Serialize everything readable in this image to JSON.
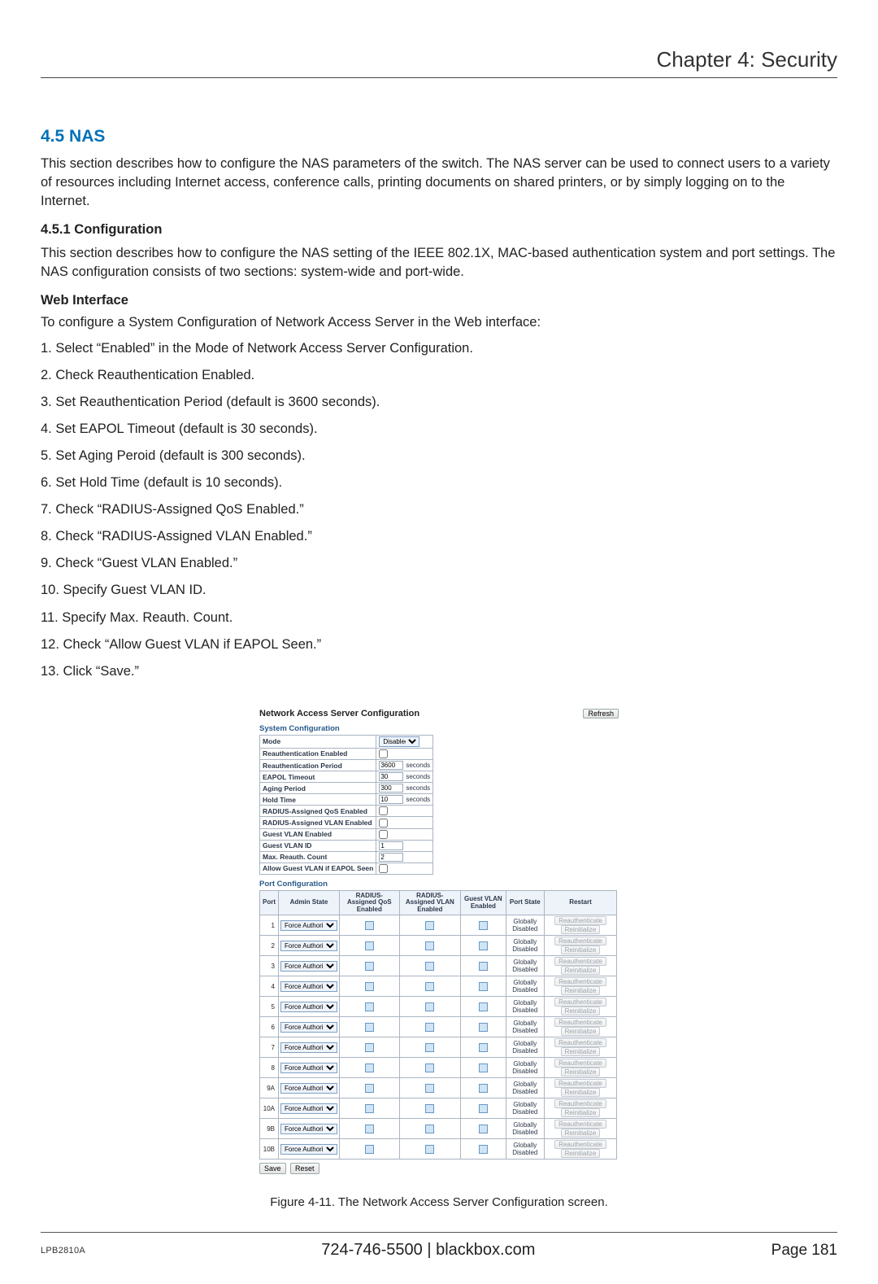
{
  "header": {
    "chapter": "Chapter 4: Security"
  },
  "section": {
    "number_title": "4.5 NAS",
    "intro": "This section describes how to configure the NAS parameters of the switch. The NAS server can be used to connect users to a variety of resources including Internet access, conference calls, printing documents on shared printers, or by simply logging on to the Internet.",
    "sub1_title": "4.5.1 Configuration",
    "sub1_text": "This section describes how to configure the NAS setting of the IEEE 802.1X, MAC-based authentication system and port settings. The NAS configuration consists of two sections: system-wide and port-wide.",
    "webif_title": "Web Interface",
    "webif_intro": "To configure a System Configuration of Network Access Server in the Web interface:",
    "steps": [
      "1. Select “Enabled” in the Mode of Network Access Server Configuration.",
      "2. Check Reauthentication Enabled.",
      "3. Set Reauthentication Period (default is 3600 seconds).",
      "4. Set EAPOL Timeout (default is 30 seconds).",
      "5. Set Aging Peroid (default is 300 seconds).",
      "6. Set Hold Time (default is 10 seconds).",
      "7. Check “RADIUS-Assigned QoS Enabled.”",
      "8. Check “RADIUS-Assigned VLAN Enabled.”",
      "9. Check “Guest VLAN Enabled.”",
      "10. Specify Guest VLAN ID.",
      "11. Specify Max. Reauth. Count.",
      "12. Check “Allow Guest VLAN if EAPOL Seen.”",
      "13. Click “Save.”"
    ]
  },
  "figure": {
    "caption": "Figure 4-11. The Network Access Server Configuration screen.",
    "panel_title": "Network Access Server Configuration",
    "refresh": "Refresh",
    "sysconf_heading": "System Configuration",
    "portconf_heading": "Port Configuration",
    "sys": {
      "mode_label": "Mode",
      "mode_value": "Disabled",
      "reauth_en_label": "Reauthentication Enabled",
      "reauth_period_label": "Reauthentication Period",
      "reauth_period_value": "3600",
      "eapol_label": "EAPOL Timeout",
      "eapol_value": "30",
      "aging_label": "Aging Period",
      "aging_value": "300",
      "hold_label": "Hold Time",
      "hold_value": "10",
      "radius_qos_label": "RADIUS-Assigned QoS Enabled",
      "radius_vlan_label": "RADIUS-Assigned VLAN Enabled",
      "guest_vlan_en_label": "Guest VLAN Enabled",
      "guest_vlan_id_label": "Guest VLAN ID",
      "guest_vlan_id_value": "1",
      "max_reauth_label": "Max. Reauth. Count",
      "max_reauth_value": "2",
      "allow_guest_label": "Allow Guest VLAN if EAPOL Seen",
      "seconds": "seconds"
    },
    "port_headers": {
      "port": "Port",
      "admin": "Admin State",
      "qos": "RADIUS-Assigned QoS Enabled",
      "rvlan": "RADIUS-Assigned VLAN Enabled",
      "gvlan": "Guest VLAN Enabled",
      "pstate": "Port State",
      "restart": "Restart"
    },
    "admin_option": "Force Authorized",
    "port_state_value": "Globally Disabled",
    "reauth_btn": "Reauthenticate",
    "reinit_btn": "Reinitialize",
    "ports": [
      "1",
      "2",
      "3",
      "4",
      "5",
      "6",
      "7",
      "8",
      "9A",
      "10A",
      "9B",
      "10B"
    ],
    "save": "Save",
    "reset": "Reset"
  },
  "footer": {
    "model": "LPB2810A",
    "contact": "724-746-5500   |   blackbox.com",
    "page": "Page 181"
  }
}
